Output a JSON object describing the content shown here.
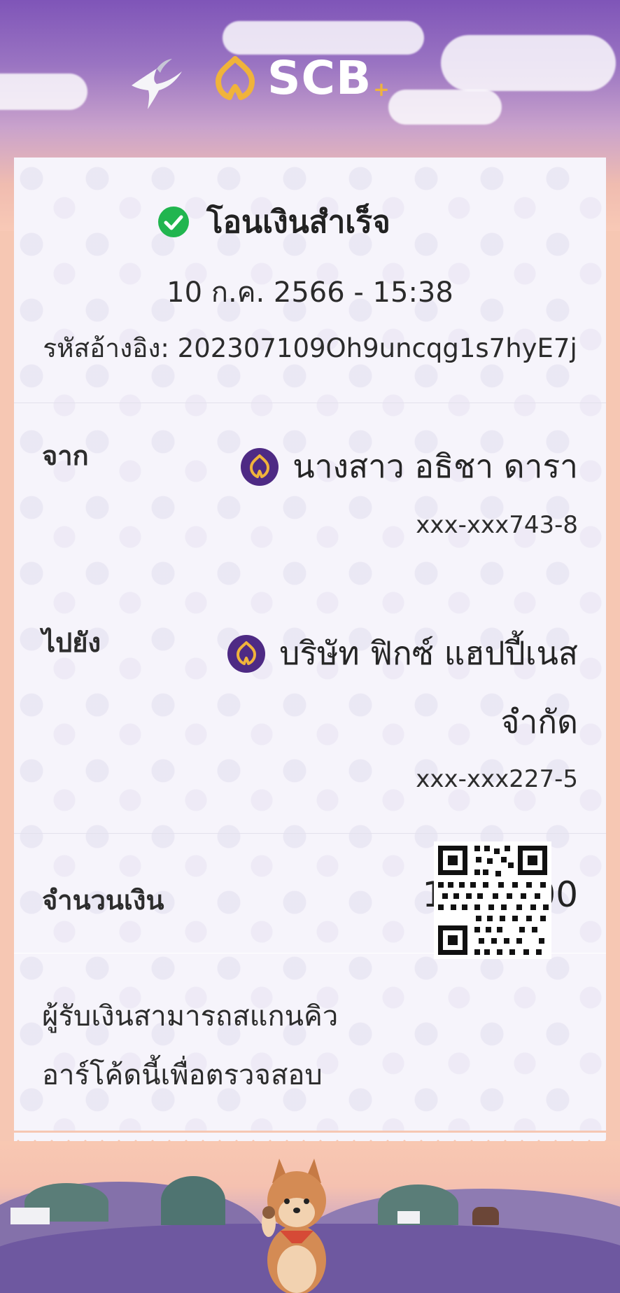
{
  "brand": {
    "logo_text": "SCB",
    "logo_suffix": "+"
  },
  "receipt": {
    "status": "โอนเงินสำเร็จ",
    "datetime": "10 ก.ค. 2566 - 15:38",
    "reference": "รหัสอ้างอิง: 202307109Oh9uncqg1s7hyE7j",
    "from_label": "จาก",
    "from_name": "นางสาว อธิชา ดารา",
    "from_account": "xxx-xxx743-8",
    "to_label": "ไปยัง",
    "to_name_line1": "บริษัท ฟิกซ์ แฮปปี้เนส",
    "to_name_line2": "จำกัด",
    "to_account": "xxx-xxx227-5",
    "amount_label": "จำนวนเงิน",
    "amount": "1,990.00",
    "note_line1": "ผู้รับเงินสามารถสแกนคิว",
    "note_line2": "อาร์โค้ดนี้เพื่อตรวจสอบ"
  },
  "icons": {
    "success": "check-circle-icon",
    "bank_logo": "scb-logo-icon",
    "qr": "qr-code-icon",
    "bird": "bird-icon",
    "dog": "dog-illustration"
  },
  "colors": {
    "brand_purple": "#4e2a84",
    "brand_gold": "#f0b33b",
    "success_green": "#21b54f",
    "receipt_bg": "#f6f4fb"
  }
}
